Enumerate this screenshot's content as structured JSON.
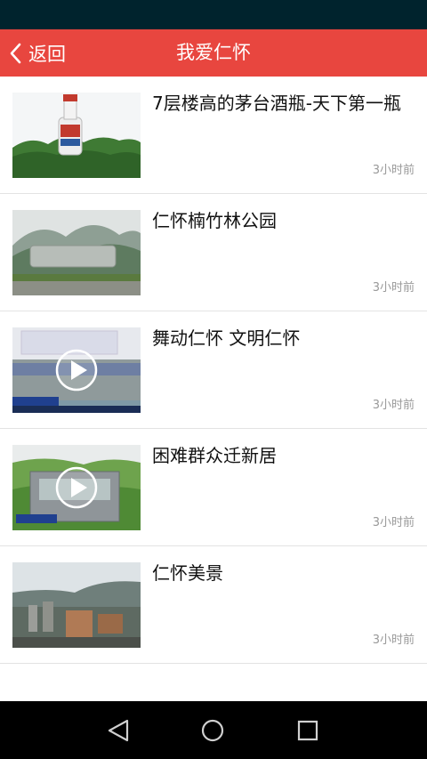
{
  "header": {
    "back_label": "返回",
    "title": "我爱仁怀"
  },
  "news": [
    {
      "title": "7层楼高的茅台酒瓶-天下第一瓶",
      "time": "3小时前",
      "has_video": false
    },
    {
      "title": "仁怀楠竹林公园",
      "time": "3小时前",
      "has_video": false
    },
    {
      "title": "舞动仁怀 文明仁怀",
      "time": "3小时前",
      "has_video": true
    },
    {
      "title": "困难群众迁新居",
      "time": "3小时前",
      "has_video": true
    },
    {
      "title": "仁怀美景",
      "time": "3小时前",
      "has_video": false
    }
  ],
  "colors": {
    "status_bar": "#00232d",
    "header": "#e8463f",
    "nav_bar": "#000000"
  },
  "nav": {
    "back_icon": "triangle-back-icon",
    "home_icon": "circle-home-icon",
    "recents_icon": "square-recents-icon"
  }
}
